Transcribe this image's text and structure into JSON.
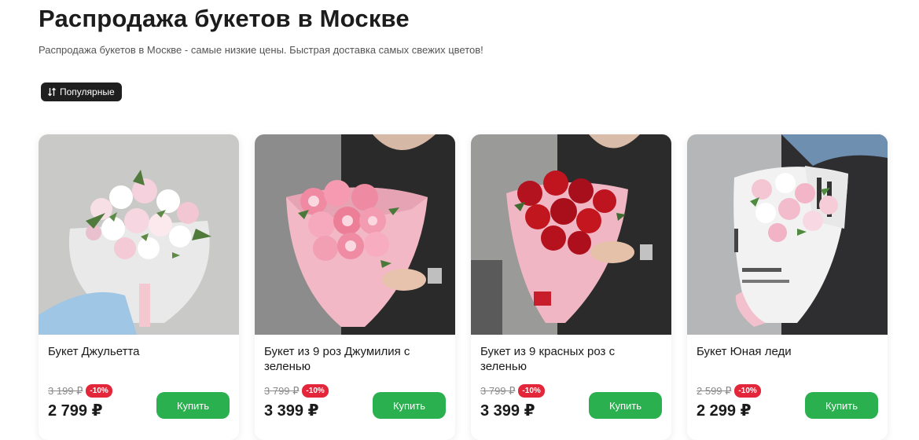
{
  "page": {
    "title": "Распродажа букетов в Москве",
    "subtitle": "Распродажа букетов в Москве - самые низкие цены. Быстрая доставка самых свежих цветов!"
  },
  "sort": {
    "label": "Популярные",
    "icon": "sort-arrows-icon"
  },
  "colors": {
    "accent_green": "#2bb04f",
    "discount_red": "#e3263a",
    "dark": "#1f1f1f"
  },
  "products": [
    {
      "name": "Букет Джульетта",
      "old_price": "3 199 ₽",
      "discount": "-10%",
      "price": "2 799 ₽",
      "buy_label": "Купить"
    },
    {
      "name": "Букет из 9 роз Джумилия с зеленью",
      "old_price": "3 799 ₽",
      "discount": "-10%",
      "price": "3 399 ₽",
      "buy_label": "Купить"
    },
    {
      "name": "Букет из 9 красных роз с зеленью",
      "old_price": "3 799 ₽",
      "discount": "-10%",
      "price": "3 399 ₽",
      "buy_label": "Купить"
    },
    {
      "name": "Букет Юная леди",
      "old_price": "2 599 ₽",
      "discount": "-10%",
      "price": "2 299 ₽",
      "buy_label": "Купить"
    }
  ]
}
